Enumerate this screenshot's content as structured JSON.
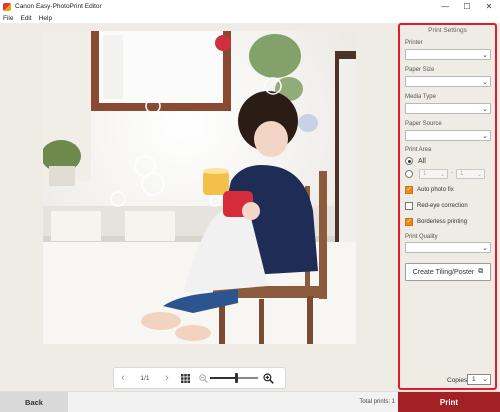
{
  "window": {
    "title": "Canon Easy-PhotoPrint Editor",
    "min": "—",
    "max": "☐",
    "close": "✕"
  },
  "menu": [
    "File",
    "Edit",
    "Help"
  ],
  "preview": {
    "page_indicator": "1/1",
    "prev": "‹",
    "next": "›",
    "zoom_level": 0.55
  },
  "panel": {
    "title": "Print Settings",
    "printer_label": "Printer",
    "paper_size_label": "Paper Size",
    "media_type_label": "Media Type",
    "paper_source_label": "Paper Source",
    "print_area_label": "Print Area",
    "all_label": "All",
    "range_from": "1",
    "range_dash": "-",
    "range_to": "1",
    "auto_fix_label": "Auto photo fix",
    "auto_fix_checked": true,
    "red_eye_label": "Red-eye correction",
    "red_eye_checked": false,
    "borderless_label": "Borderless printing",
    "borderless_checked": true,
    "print_quality_label": "Print Quality",
    "tiling_button": "Create Tiling/Poster",
    "copies_label": "Copies",
    "copies_value": "1",
    "highlight_color": "#e21b2e"
  },
  "footer": {
    "back": "Back",
    "total_prints": "Total prints: 1",
    "print": "Print",
    "print_color": "#a32024"
  }
}
